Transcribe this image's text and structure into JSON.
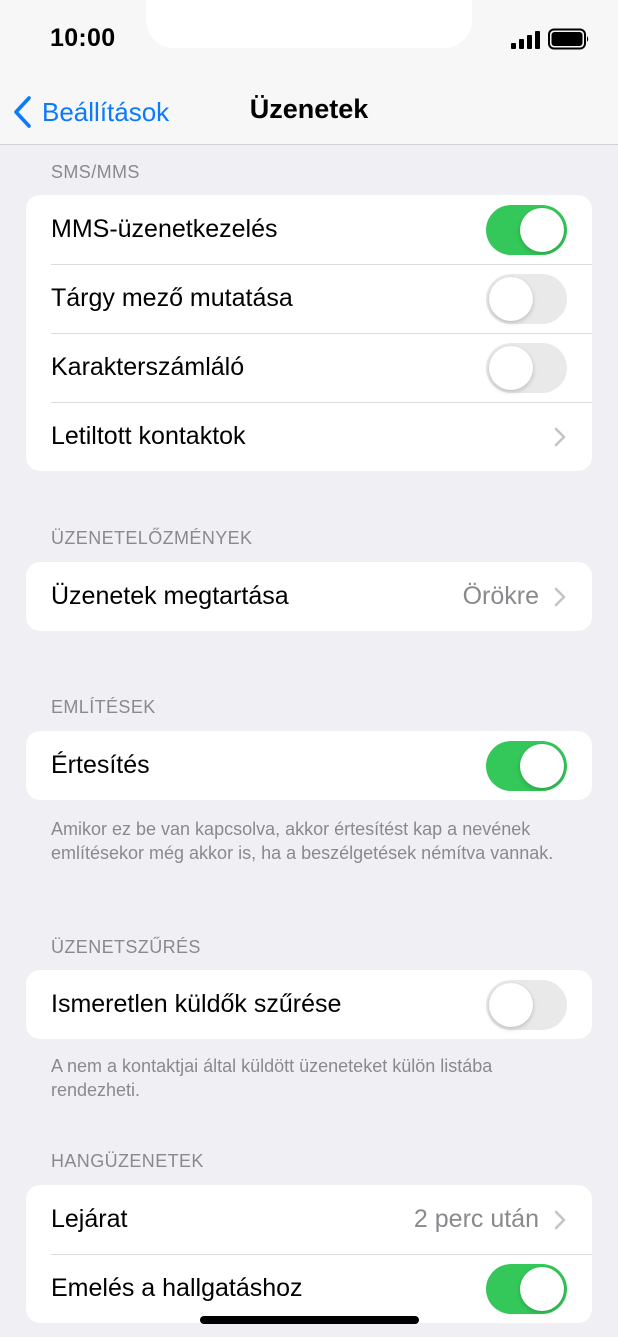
{
  "status_bar": {
    "time": "10:00",
    "signal_icon": "cellular-signal-icon",
    "battery_icon": "battery-full-icon"
  },
  "nav": {
    "back_label": "Beállítások",
    "title": "Üzenetek",
    "back_icon": "chevron-left-icon"
  },
  "sections": {
    "sms": {
      "header": "SMS/MMS",
      "rows": [
        {
          "label": "MMS-üzenetkezelés",
          "toggle": true
        },
        {
          "label": "Tárgy mező mutatása",
          "toggle": false
        },
        {
          "label": "Karakterszámláló",
          "toggle": false
        },
        {
          "label": "Letiltott kontaktok"
        }
      ]
    },
    "history": {
      "header": "ÜZENETELŐZMÉNYEK",
      "rows": [
        {
          "label": "Üzenetek megtartása",
          "value": "Örökre"
        }
      ]
    },
    "mentions": {
      "header": "EMLÍTÉSEK",
      "rows": [
        {
          "label": "Értesítés",
          "toggle": true
        }
      ],
      "footer": "Amikor ez be van kapcsolva, akkor értesítést kap a nevének említésekor még akkor is, ha a beszélgetések némítva vannak."
    },
    "filtering": {
      "header": "ÜZENETSZŰRÉS",
      "rows": [
        {
          "label": "Ismeretlen küldők szűrése",
          "toggle": false
        }
      ],
      "footer": "A nem a kontaktjai által küldött üzeneteket külön listába rendezheti."
    },
    "audio": {
      "header": "HANGÜZENETEK",
      "rows": [
        {
          "label": "Lejárat",
          "value": "2 perc után"
        },
        {
          "label": "Emelés a hallgatáshoz",
          "toggle": true
        }
      ]
    }
  },
  "colors": {
    "accent": "#0a7aff",
    "toggle_on": "#34c759",
    "toggle_off": "#e9e9ea",
    "background": "#efeff4",
    "secondary_text": "#8a8a8e"
  }
}
